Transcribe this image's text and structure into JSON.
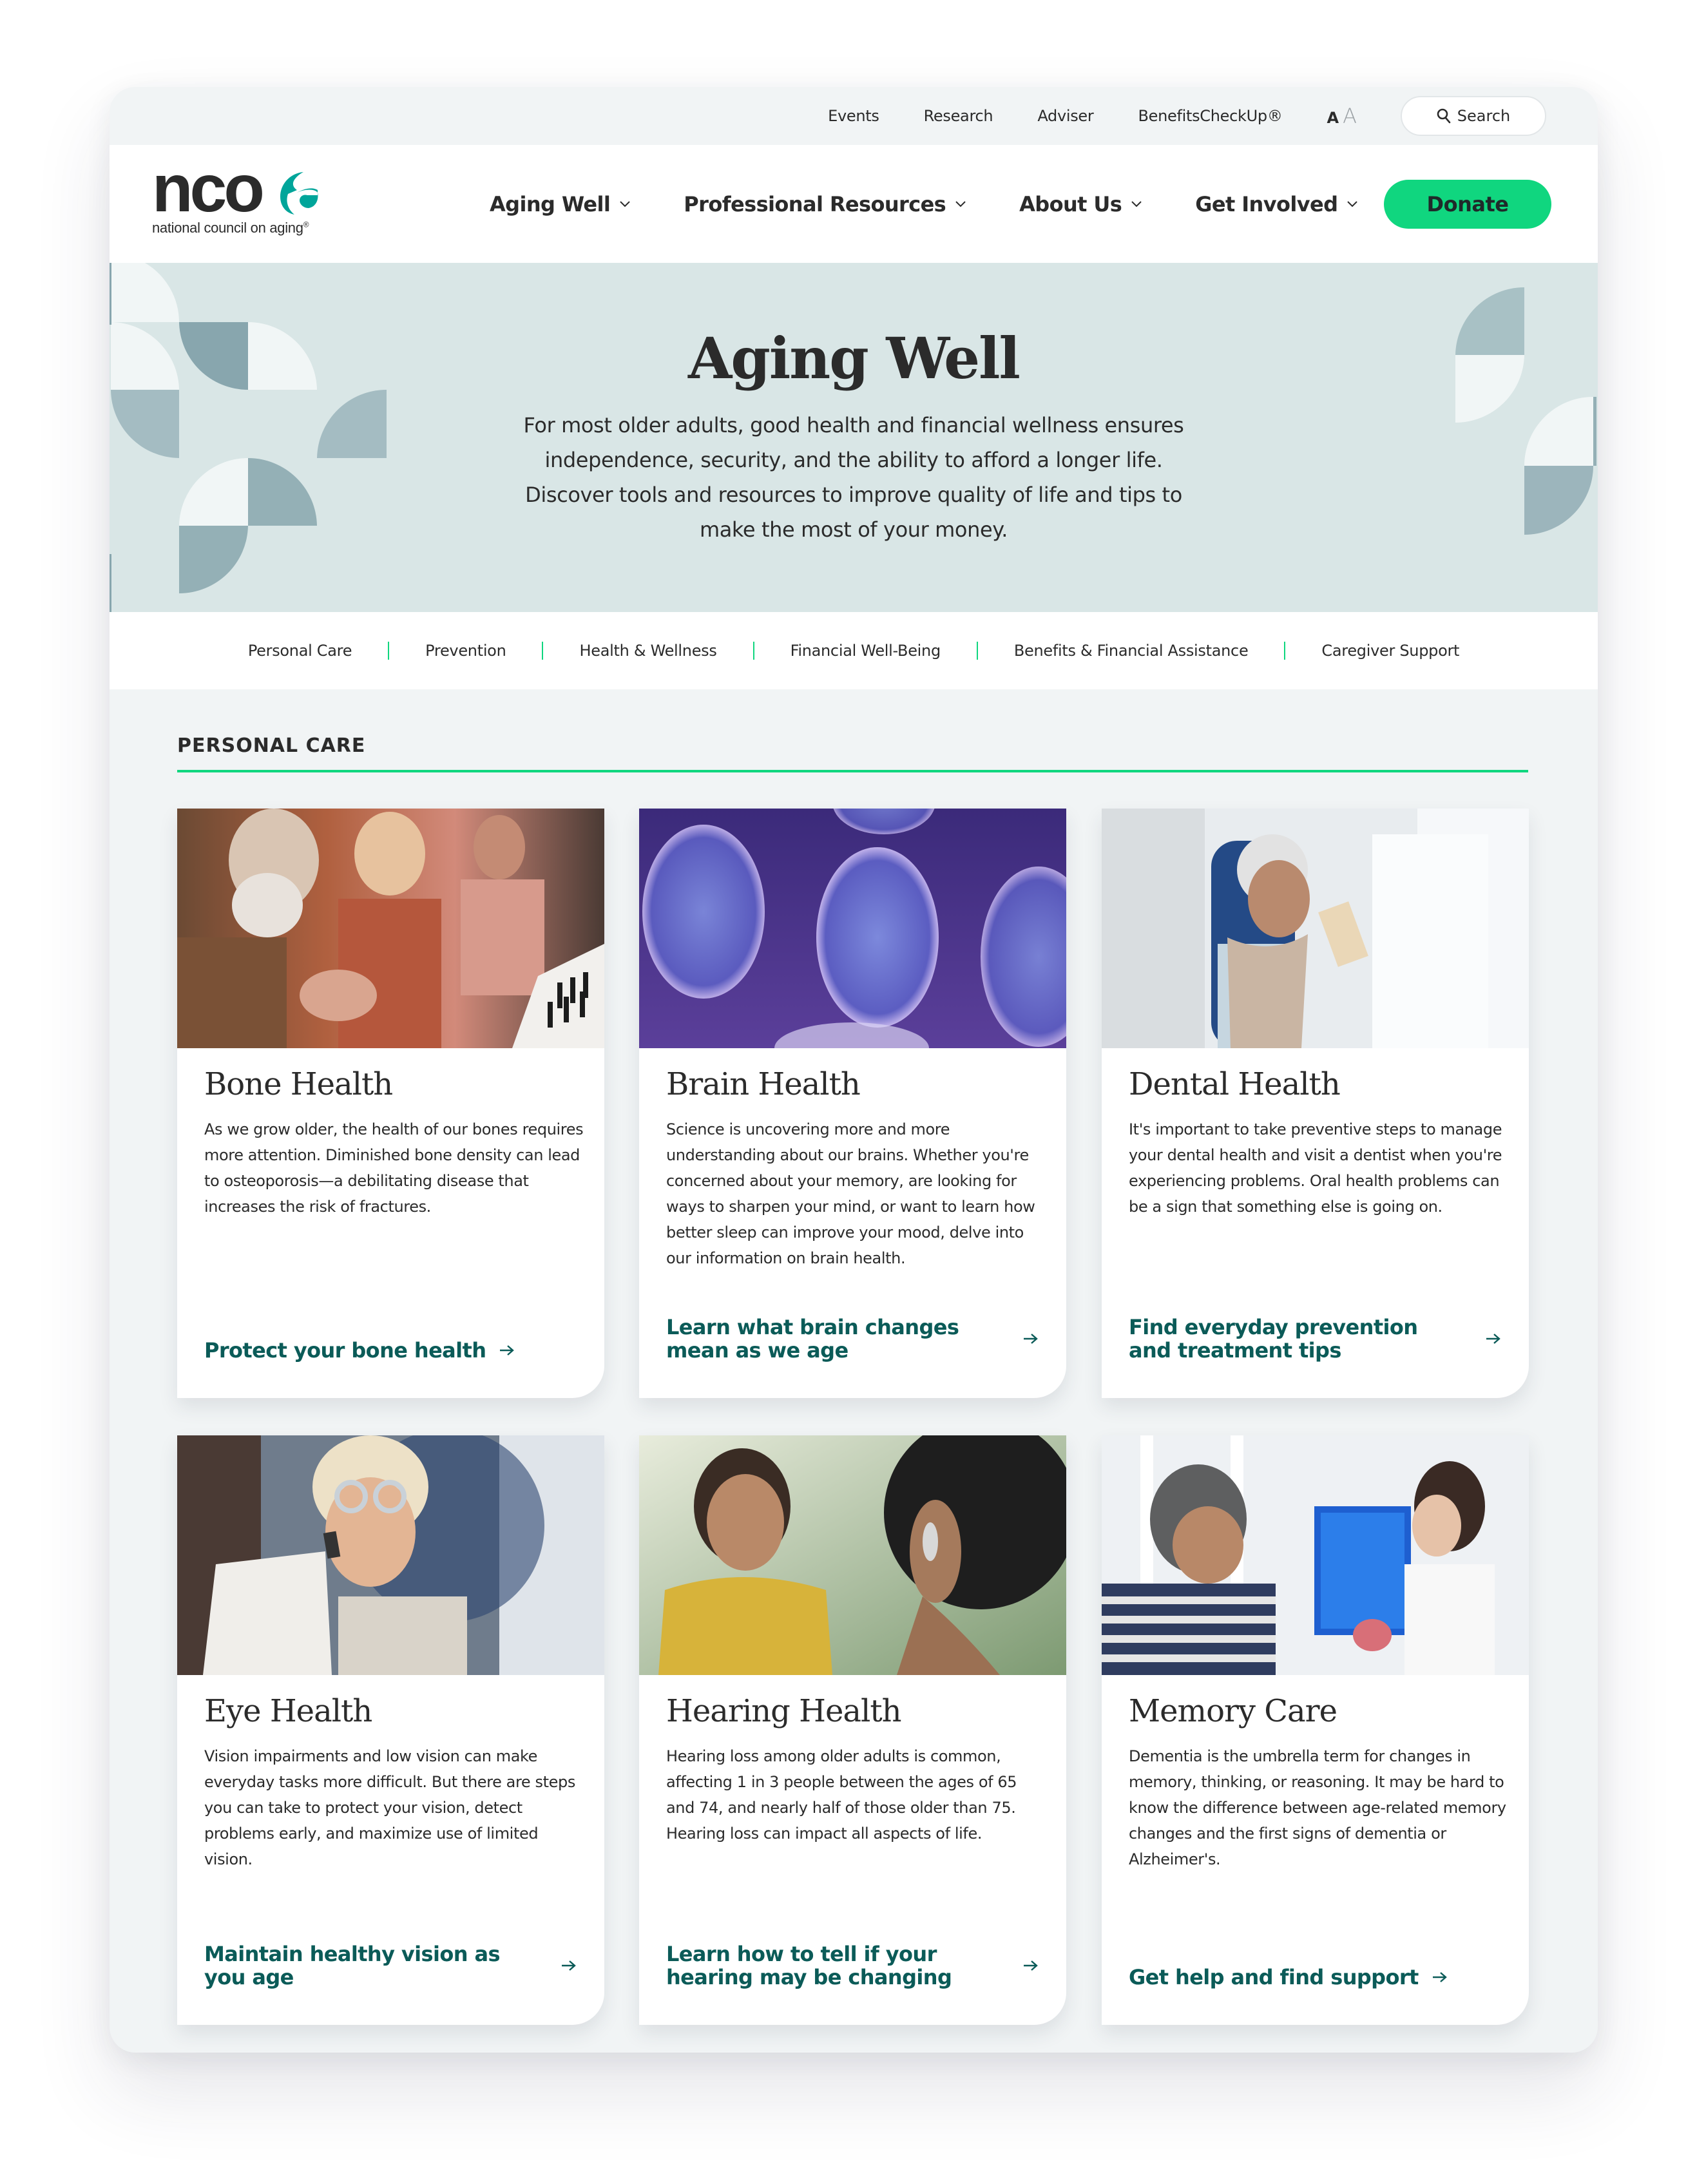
{
  "utility": {
    "links": [
      "Events",
      "Research",
      "Adviser",
      "BenefitsCheckUp®"
    ],
    "text_size": {
      "small": "A",
      "large": "A"
    },
    "search_label": "Search"
  },
  "brand": {
    "wordmark": "nco",
    "tagline": "national council on aging",
    "registered": "®",
    "accent_color": "#00a59a"
  },
  "nav": {
    "items": [
      "Aging Well",
      "Professional Resources",
      "About Us",
      "Get Involved"
    ],
    "donate_label": "Donate",
    "donate_color": "#10d67f"
  },
  "hero": {
    "title": "Aging Well",
    "description": "For most older adults, good health and financial wellness ensures independence, security, and the ability to afford a longer life. Discover tools and resources to improve quality of life and tips to make the most of your money."
  },
  "subnav": {
    "items": [
      "Personal Care",
      "Prevention",
      "Health & Wellness",
      "Financial Well-Being",
      "Benefits & Financial Assistance",
      "Caregiver Support"
    ]
  },
  "section": {
    "title": "PERSONAL CARE",
    "rule_color": "#10d67f"
  },
  "cards": [
    {
      "title": "Bone Health",
      "description": "As we grow older, the health of our bones requires more attention. Diminished bone density can lead to osteoporosis—a debilitating disease that increases the risk of fractures.",
      "cta": "Protect your bone health",
      "image": "older man, woman and girl playing piano"
    },
    {
      "title": "Brain Health",
      "description": "Science is uncovering more and more understanding about our brains. Whether you're concerned about your memory, are looking for ways to sharpen your mind, or want to learn how better sleep can improve your mood, delve into our information on brain health.",
      "cta": "Learn what brain changes mean as we age",
      "image": "brain MRI scans"
    },
    {
      "title": "Dental Health",
      "description": "It's important to take preventive steps to manage your dental health and visit a dentist when you're experiencing problems. Oral health problems can be a sign that something else is going on.",
      "cta": "Find everyday prevention and treatment tips",
      "image": "smiling older woman in dentist chair"
    },
    {
      "title": "Eye Health",
      "description": "Vision impairments and low vision can make everyday tasks more difficult. But there are steps you can take to protect your vision, detect problems early, and maximize use of limited vision.",
      "cta": "Maintain healthy vision as you age",
      "image": "woman with trial eyeglass frame at eye exam"
    },
    {
      "title": "Hearing Health",
      "description": "Hearing loss among older adults is common, affecting 1 in 3 people between the ages of 65 and 74, and nearly half of those older than 75. Hearing loss can impact all aspects of life.",
      "cta": "Learn how to tell if your hearing may be changing",
      "image": "woman with hearing aid talking to friend"
    },
    {
      "title": "Memory Care",
      "description": "Dementia is the umbrella term for changes in memory, thinking, or reasoning. It may be hard to know the difference between age-related memory changes and the first signs of dementia or Alzheimer's.",
      "cta": "Get help and find support",
      "image": "doctor showing brain model to older man"
    }
  ]
}
